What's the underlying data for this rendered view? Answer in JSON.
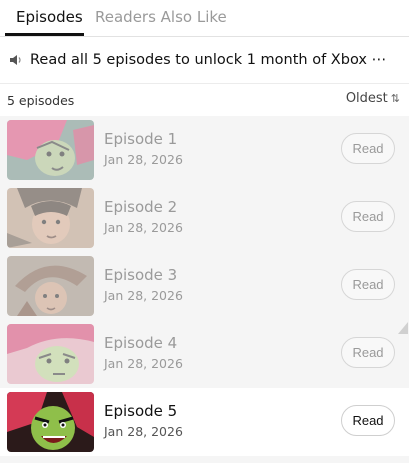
{
  "tabs": {
    "episodes": "Episodes",
    "readers_also_like": "Readers Also Like"
  },
  "notice": {
    "icon": "speaker-icon",
    "text": "Read all 5 episodes to unlock 1 month of Xbox ⋯"
  },
  "list_header": {
    "count": "5 episodes",
    "sort_label": "Oldest",
    "sort_icon": "⇅"
  },
  "episodes": [
    {
      "title": "Episode 1",
      "date": "Jan 28, 2026",
      "action": "Read",
      "read": true
    },
    {
      "title": "Episode 2",
      "date": "Jan 28, 2026",
      "action": "Read",
      "read": true
    },
    {
      "title": "Episode 3",
      "date": "Jan 28, 2026",
      "action": "Read",
      "read": true
    },
    {
      "title": "Episode 4",
      "date": "Jan 28, 2026",
      "action": "Read",
      "read": true
    },
    {
      "title": "Episode 5",
      "date": "Jan 28, 2026",
      "action": "Read",
      "read": false
    }
  ],
  "colors": {
    "accent": "#111111",
    "muted_text": "#9a9a9a",
    "list_background": "#f5f5f5"
  }
}
